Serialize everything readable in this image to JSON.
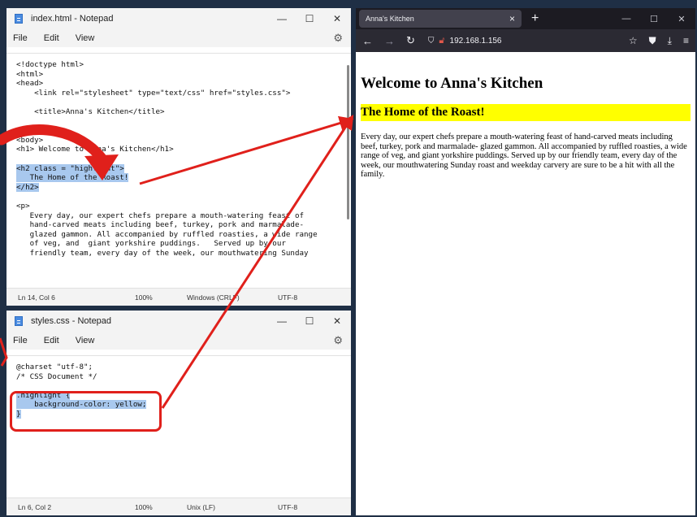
{
  "notepad_top": {
    "title": "index.html - Notepad",
    "menu": [
      "File",
      "Edit",
      "View"
    ],
    "code_lines": [
      {
        "text": "<!doctype html>",
        "sel": false
      },
      {
        "text": "<html>",
        "sel": false
      },
      {
        "text": "<head>",
        "sel": false
      },
      {
        "text": "    <link rel=\"stylesheet\" type=\"text/css\" href=\"styles.css\">",
        "sel": false
      },
      {
        "text": "",
        "sel": false
      },
      {
        "text": "    <title>Anna's Kitchen</title>",
        "sel": false
      },
      {
        "text": "",
        "sel": false
      },
      {
        "text": "",
        "sel": false
      },
      {
        "text": "<body>",
        "sel": false
      },
      {
        "text": "<h1> Welcome to Anna's Kitchen</h1>",
        "sel": false
      },
      {
        "text": "",
        "sel": false
      },
      {
        "text": "<h2 class = \"highlight\">",
        "sel": true
      },
      {
        "text": "   The Home of the Roast!",
        "sel": true
      },
      {
        "text": "</h2>",
        "sel": true
      },
      {
        "text": "",
        "sel": false
      },
      {
        "text": "<p>",
        "sel": false
      },
      {
        "text": "   Every day, our expert chefs prepare a mouth-watering feast of",
        "sel": false
      },
      {
        "text": "   hand-carved meats including beef, turkey, pork and marmalade-",
        "sel": false
      },
      {
        "text": "   glazed gammon. All accompanied by ruffled roasties, a wide range",
        "sel": false
      },
      {
        "text": "   of veg, and  giant yorkshire puddings.   Served up by our",
        "sel": false
      },
      {
        "text": "   friendly team, every day of the week, our mouthwatering Sunday",
        "sel": false
      }
    ],
    "status": {
      "position": "Ln 14, Col 6",
      "zoom": "100%",
      "line_ending": "Windows (CRLF)",
      "encoding": "UTF-8"
    }
  },
  "notepad_bottom": {
    "title": "styles.css - Notepad",
    "menu": [
      "File",
      "Edit",
      "View"
    ],
    "code_lines": [
      {
        "text": "@charset \"utf-8\";",
        "sel": false
      },
      {
        "text": "/* CSS Document */",
        "sel": false
      },
      {
        "text": "",
        "sel": false
      },
      {
        "text": ".highlight {",
        "sel": true
      },
      {
        "text": "    background-color: yellow;",
        "sel": true
      },
      {
        "text": "}",
        "sel": true
      }
    ],
    "status": {
      "position": "Ln 6, Col 2",
      "zoom": "100%",
      "line_ending": "Unix (LF)",
      "encoding": "UTF-8"
    }
  },
  "browser": {
    "tab_title": "Anna's Kitchen",
    "url": "192.168.1.156",
    "page": {
      "h1": "Welcome to Anna's Kitchen",
      "h2": "The Home of the Roast!",
      "paragraph": "Every day, our expert chefs prepare a mouth-watering feast of hand-carved meats including beef, turkey, pork and marmalade- glazed gammon. All accompanied by ruffled roasties, a wide range of veg, and giant yorkshire puddings. Served up by our friendly team, every day of the week, our mouthwatering Sunday roast and weekday carvery are sure to be a hit with all the family."
    }
  },
  "colors": {
    "highlight": "#ffff00",
    "selection": "#a8c8ee",
    "annotation": "#e0201b"
  }
}
